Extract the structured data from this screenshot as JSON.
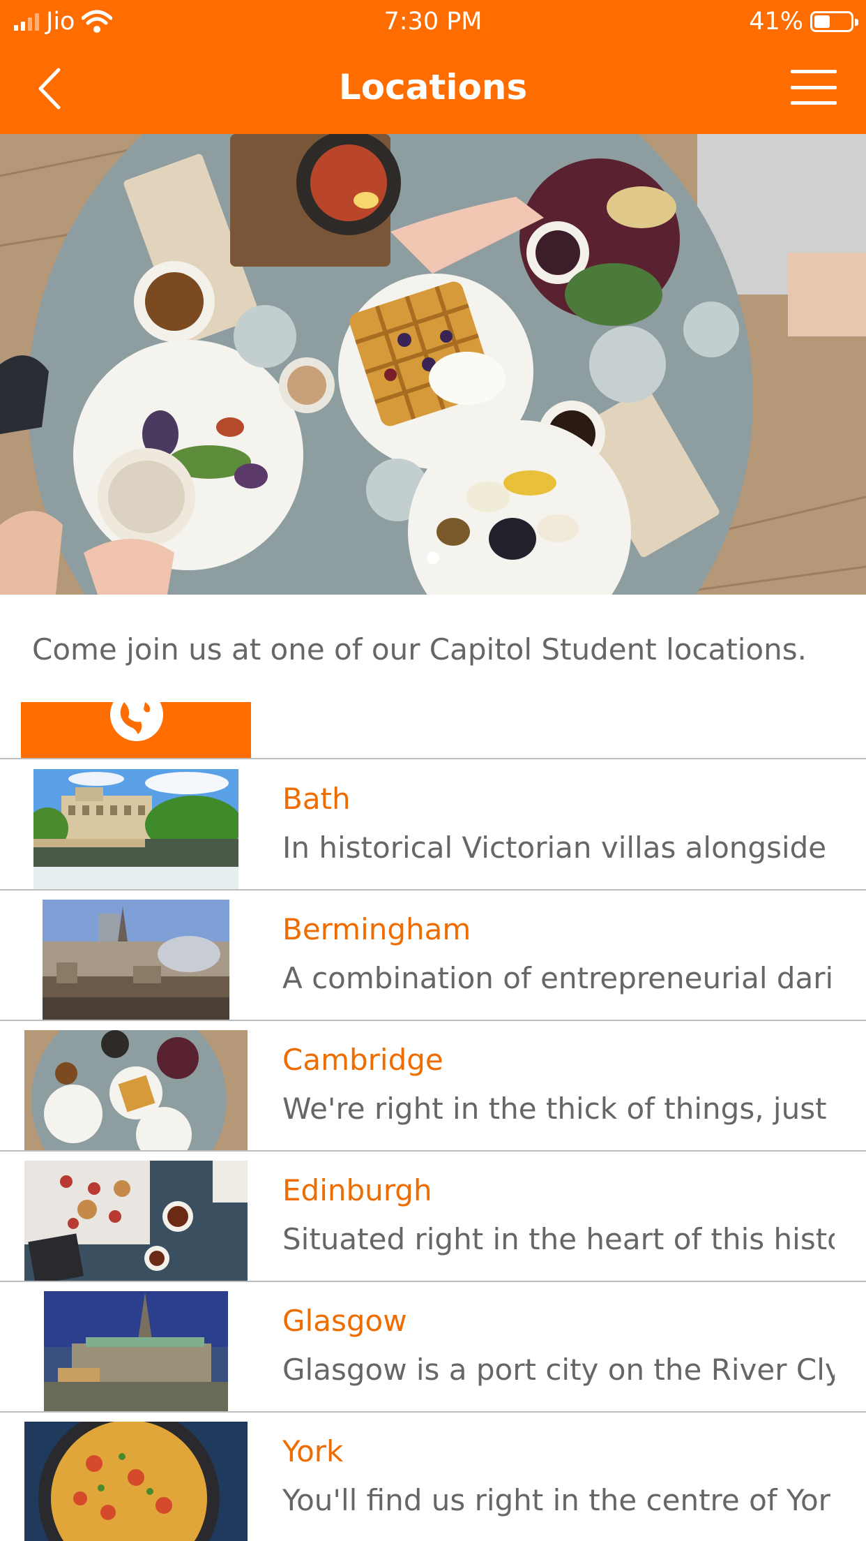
{
  "status_bar": {
    "carrier": "Jio",
    "time": "7:30 PM",
    "battery": "41%"
  },
  "header": {
    "title": "Locations",
    "back_icon": "chevron-left-icon",
    "menu_icon": "hamburger-menu-icon"
  },
  "hero": {
    "image": "breakfast-table-photo",
    "slide_count": 1,
    "active_slide": 1
  },
  "intro_text": "Come join us at one of our Capitol Student locations.",
  "tabs": [
    {
      "icon": "globe-icon",
      "active": true
    }
  ],
  "locations": [
    {
      "name": "Bath",
      "description": "In historical Victorian villas alongside a",
      "image": "bath-river-photo"
    },
    {
      "name": "Bermingham",
      "description": "A combination of entrepreneurial dari",
      "image": "birmingham-skyline-photo"
    },
    {
      "name": "Cambridge",
      "description": "We're right in the thick of things, just a",
      "image": "breakfast-table-photo"
    },
    {
      "name": "Edinburgh",
      "description": "Situated right in the heart of this histo",
      "image": "tea-pastries-photo"
    },
    {
      "name": "Glasgow",
      "description": "Glasgow is a port city on the River Clyc",
      "image": "glasgow-cathedral-photo"
    },
    {
      "name": "York",
      "description": "You'll find us right in the centre of Yor",
      "image": "paella-dish-photo"
    }
  ],
  "colors": {
    "accent": "#ff6d00",
    "title_text": "#ef6c00",
    "body_text": "#666666",
    "divider": "#bdbdbd"
  }
}
